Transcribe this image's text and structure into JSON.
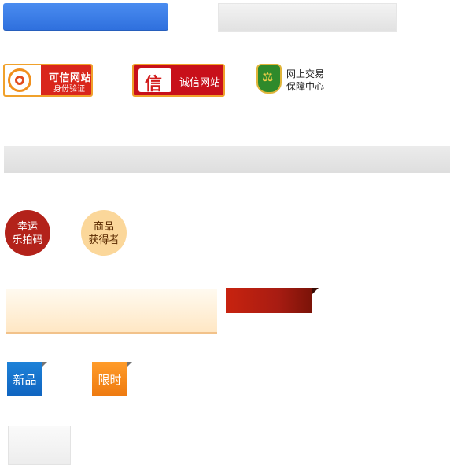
{
  "badges": {
    "trusted_site": {
      "line1": "可信网站",
      "line2": "身份验证"
    },
    "integrity_site": {
      "seal": "信",
      "label": "诚信网站"
    },
    "trade_guarantee": {
      "line1": "网上交易",
      "line2": "保障中心",
      "icon": "scale-shield-icon"
    }
  },
  "circles": {
    "lucky": {
      "line1": "幸运",
      "line2": "乐拍码"
    },
    "winner": {
      "line1": "商品",
      "line2": "获得者"
    }
  },
  "tags": {
    "new": "新品",
    "limited": "限时"
  },
  "colors": {
    "primary_blue": "#2e6fdd",
    "badge_red": "#d9261c",
    "tag_blue": "#1e82d8",
    "tag_orange": "#ff9c2a",
    "ribbon_red": "#a81c12"
  }
}
